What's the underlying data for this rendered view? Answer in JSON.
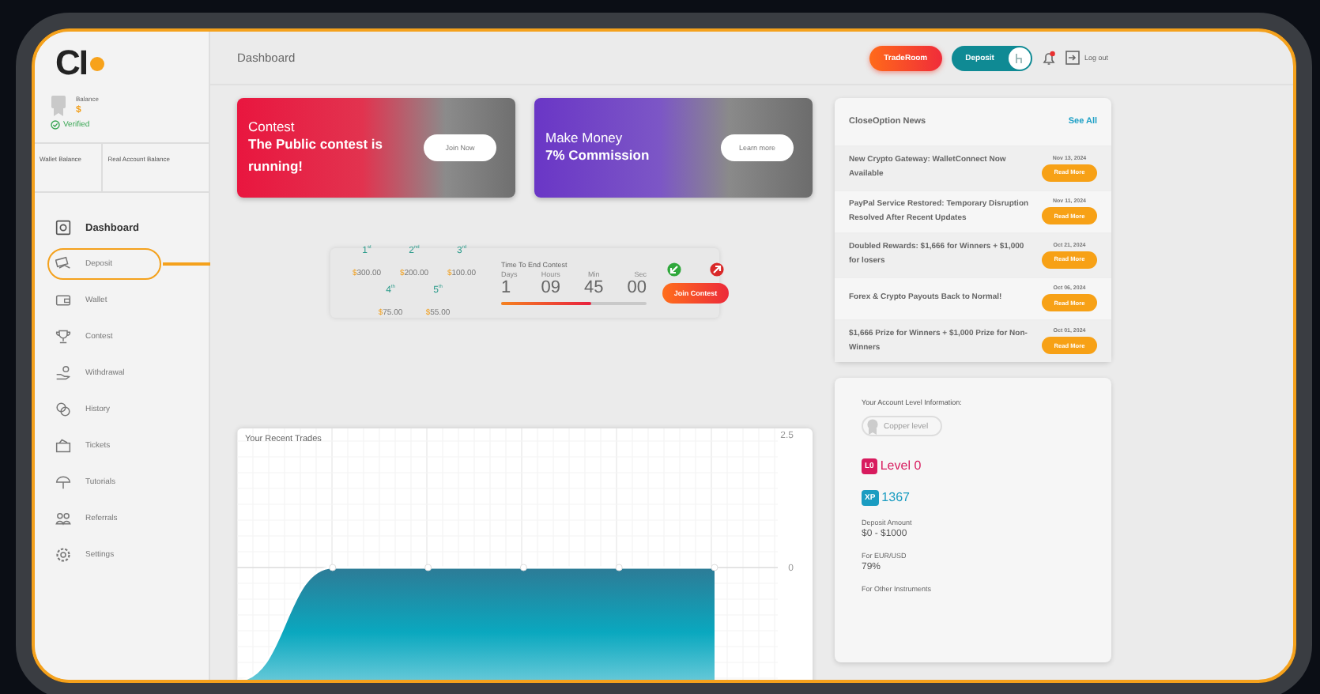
{
  "logo": {
    "text": "CI"
  },
  "account": {
    "balance_label": "Balance",
    "balance": "$",
    "status": "Verified"
  },
  "balances": [
    "Wallet Balance",
    "Real Account Balance"
  ],
  "sidebar": {
    "items": [
      {
        "label": "Dashboard",
        "selected": true,
        "highlighted": false
      },
      {
        "label": "Deposit",
        "selected": false,
        "highlighted": true
      },
      {
        "label": "Wallet",
        "selected": false,
        "highlighted": false
      },
      {
        "label": "Contest",
        "selected": false,
        "highlighted": false
      },
      {
        "label": "Withdrawal",
        "selected": false,
        "highlighted": false
      },
      {
        "label": "History",
        "selected": false,
        "highlighted": false
      },
      {
        "label": "Tickets",
        "selected": false,
        "highlighted": false
      },
      {
        "label": "Tutorials",
        "selected": false,
        "highlighted": false
      },
      {
        "label": "Referrals",
        "selected": false,
        "highlighted": false
      },
      {
        "label": "Settings",
        "selected": false,
        "highlighted": false
      }
    ]
  },
  "header": {
    "title": "Dashboard",
    "trade_button": "TradeRoom",
    "deposit_button": "Deposit",
    "logout": "Log out"
  },
  "banners": [
    {
      "kind": "contest",
      "eyebrow": "Contest",
      "title": "The Public contest is running!",
      "button": "Join Now"
    },
    {
      "kind": "commission",
      "eyebrow": "Make Money",
      "title": "7% Commission",
      "button": "Learn more"
    }
  ],
  "contest": {
    "prizes": [
      {
        "place": "1$^{st}$",
        "currency": "$",
        "amount": "300.00"
      },
      {
        "place": "2$^{nd}$",
        "currency": "$",
        "amount": "200.00"
      },
      {
        "place": "3$^{rd}$",
        "currency": "$",
        "amount": "100.00"
      },
      {
        "place": "4$^{th}$",
        "currency": "$",
        "amount": "75.00"
      },
      {
        "place": "5$^{th}$",
        "currency": "$",
        "amount": "55.00"
      }
    ],
    "timer": {
      "title": "Time To End Contest",
      "level": 0.62,
      "units": [
        {
          "label": "Days",
          "value": "1"
        },
        {
          "label": "Hours",
          "value": "09"
        },
        {
          "label": "Min",
          "value": "45"
        },
        {
          "label": "Sec",
          "value": "00"
        }
      ]
    },
    "button": "Join Contest"
  },
  "chart": {
    "chart_data": {
      "type": "area",
      "title": "Your Recent Trades",
      "values": [
        -2.1,
        0,
        0,
        0,
        0,
        0
      ],
      "ylim": [
        -2.1,
        2.5
      ],
      "yticks": [
        0,
        2.5
      ],
      "grid": true
    }
  },
  "news": {
    "title": "CloseOption News",
    "link": "See All",
    "items": [
      {
        "title": "New Crypto Gateway: WalletConnect Now Available",
        "date": "Nov 13, 2024",
        "button": "Read More"
      },
      {
        "title": "PayPal Service Restored: Temporary Disruption Resolved After Recent Updates",
        "date": "Nov 11, 2024",
        "button": "Read More"
      },
      {
        "title": "Doubled Rewards: $1,666 for Winners + $1,000 for losers",
        "date": "Oct 21, 2024",
        "button": "Read More"
      },
      {
        "title": "Forex & Crypto Payouts Back to Normal!",
        "date": "Oct 06, 2024",
        "button": "Read More"
      },
      {
        "title": "$1,666 Prize for Winners + $1,000 Prize for Non-Winners",
        "date": "Oct 01, 2024",
        "button": "Read More"
      }
    ]
  },
  "level_card": {
    "heading": "Your Account Level Information:",
    "badge": "Copper level",
    "level_tag": "L0",
    "level": "Level 0",
    "xp_tag": "XP",
    "xp": "1367",
    "details": [
      {
        "label": "Deposit Amount",
        "value": "$0 - $1000"
      },
      {
        "label": "For EUR/USD",
        "value": "79%"
      },
      {
        "label": "For Other Instruments"
      }
    ]
  }
}
